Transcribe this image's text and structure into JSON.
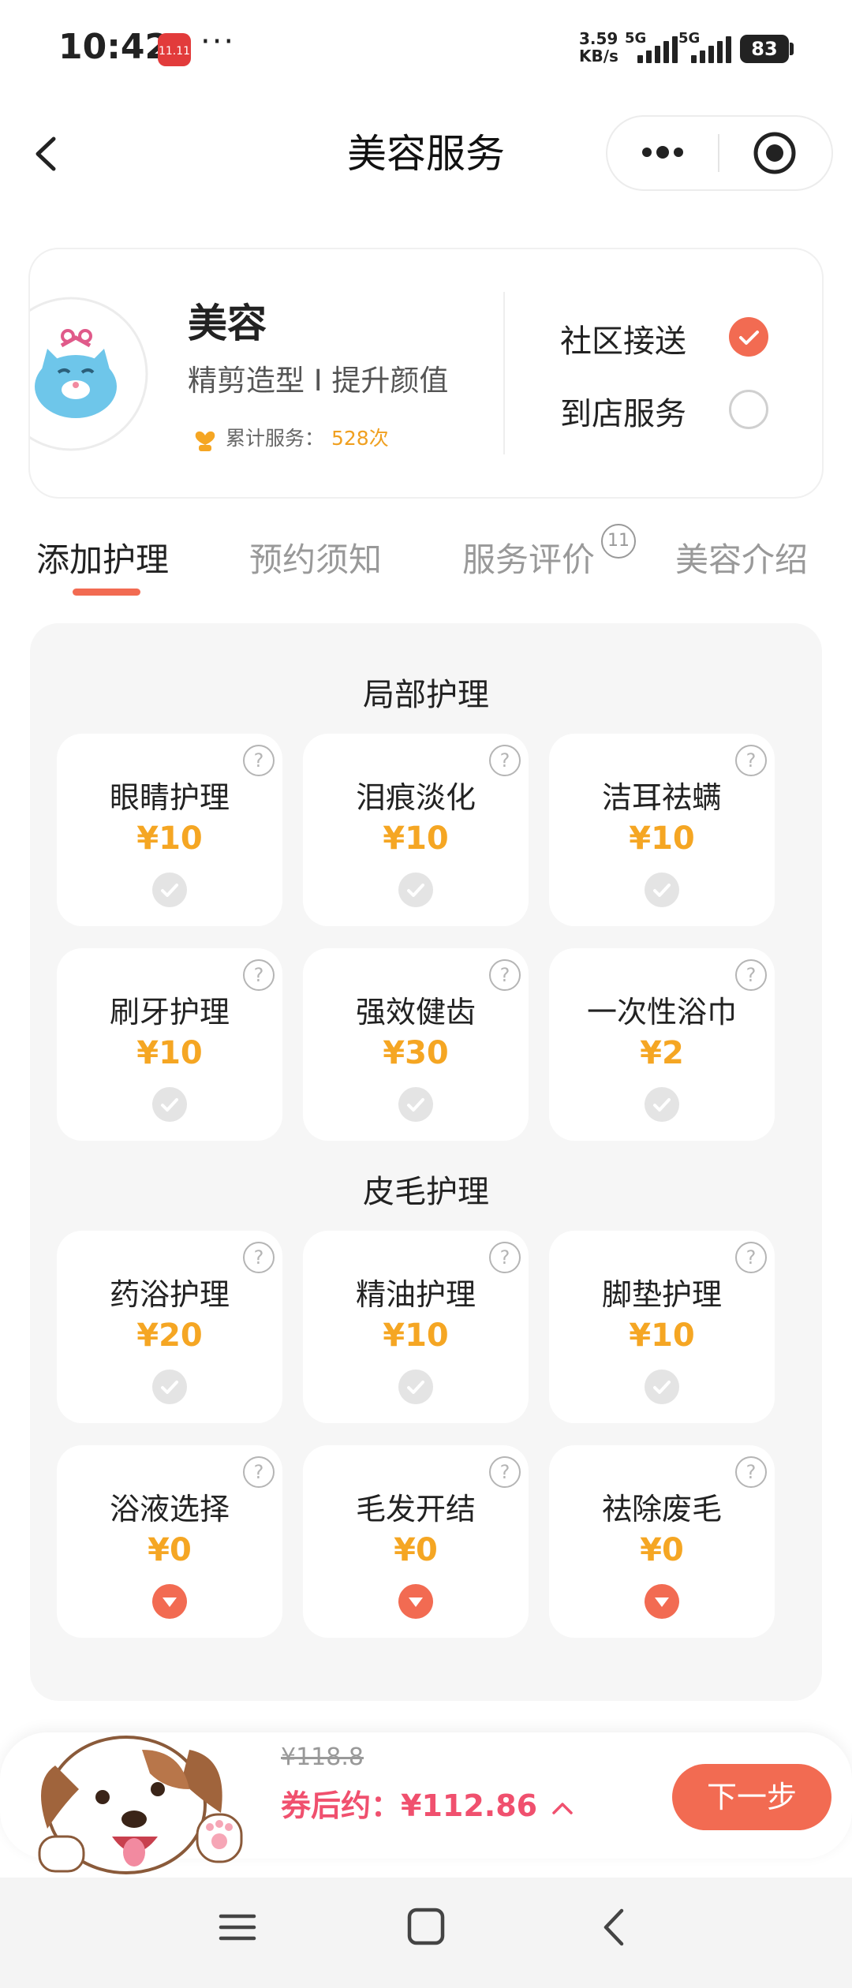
{
  "status_bar": {
    "time": "10:42",
    "app_badge": "11.11",
    "more": "···",
    "net_speed_value": "3.59",
    "net_speed_unit": "KB/s",
    "signal1": "5G",
    "signal2": "5G",
    "battery": "83"
  },
  "nav": {
    "title": "美容服务"
  },
  "service": {
    "name": "美容",
    "desc": "精剪造型 I 提升颜值",
    "served_label": "累计服务：",
    "served_count": "528次",
    "options": [
      {
        "label": "社区接送",
        "checked": true
      },
      {
        "label": "到店服务",
        "checked": false
      }
    ]
  },
  "tabs": [
    {
      "label": "添加护理",
      "active": true
    },
    {
      "label": "预约须知",
      "active": false
    },
    {
      "label": "服务评价",
      "active": false,
      "badge": "11"
    },
    {
      "label": "美容介绍",
      "active": false
    }
  ],
  "sections": [
    {
      "title": "局部护理",
      "items": [
        {
          "name": "眼睛护理",
          "price": "¥10",
          "state": "check"
        },
        {
          "name": "泪痕淡化",
          "price": "¥10",
          "state": "check"
        },
        {
          "name": "洁耳祛螨",
          "price": "¥10",
          "state": "check"
        },
        {
          "name": "刷牙护理",
          "price": "¥10",
          "state": "check"
        },
        {
          "name": "强效健齿",
          "price": "¥30",
          "state": "check"
        },
        {
          "name": "一次性浴巾",
          "price": "¥2",
          "state": "check"
        }
      ]
    },
    {
      "title": "皮毛护理",
      "items": [
        {
          "name": "药浴护理",
          "price": "¥20",
          "state": "check"
        },
        {
          "name": "精油护理",
          "price": "¥10",
          "state": "check"
        },
        {
          "name": "脚垫护理",
          "price": "¥10",
          "state": "check"
        },
        {
          "name": "浴液选择",
          "price": "¥0",
          "state": "dropdown"
        },
        {
          "name": "毛发开结",
          "price": "¥0",
          "state": "dropdown"
        },
        {
          "name": "祛除废毛",
          "price": "¥0",
          "state": "dropdown"
        }
      ]
    }
  ],
  "footer": {
    "original_price": "¥118.8",
    "coupon_price": "券后约：¥112.86",
    "next_label": "下一步"
  },
  "colors": {
    "accent": "#f26b52",
    "price": "#f5a623",
    "coupon": "#f0506e"
  }
}
